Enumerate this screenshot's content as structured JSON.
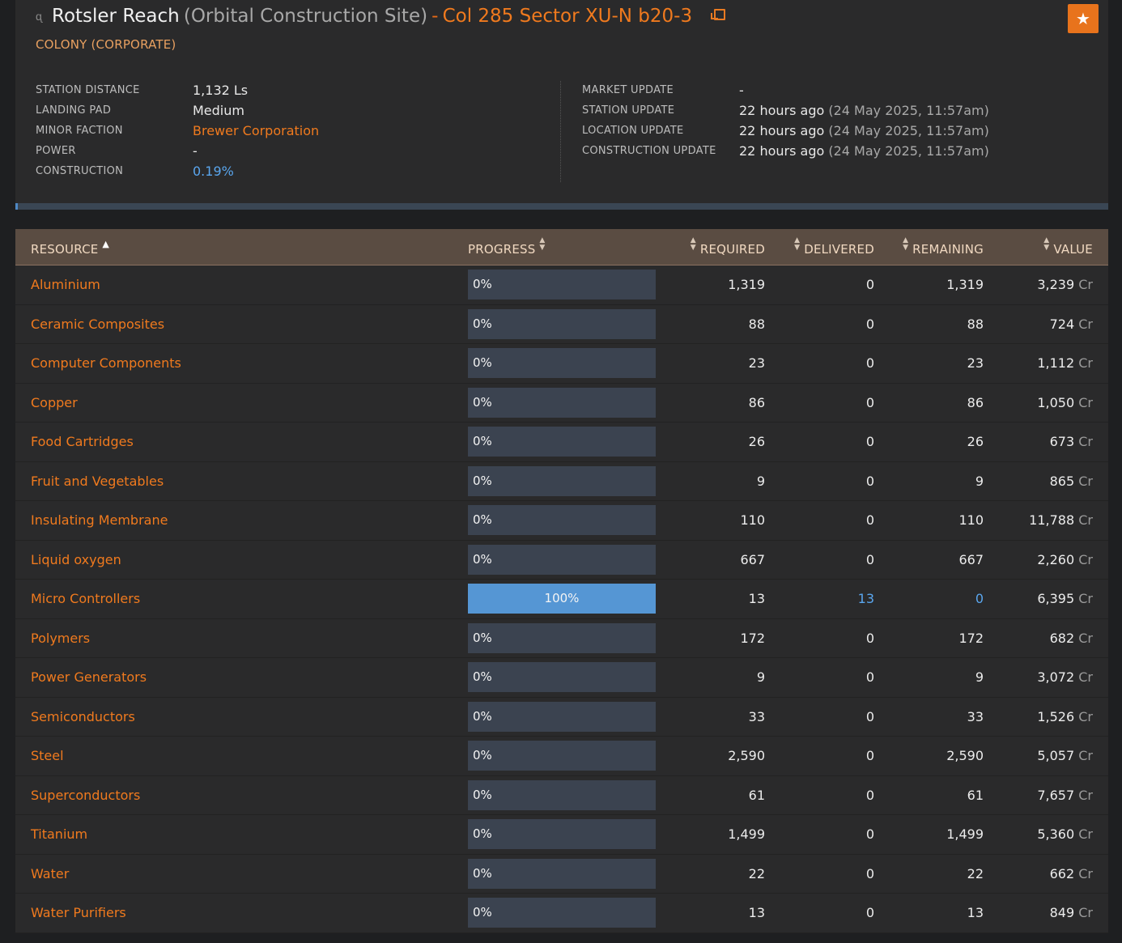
{
  "header": {
    "station_name": "Rotsler Reach",
    "station_type": "(Orbital Construction Site)",
    "separator": "-",
    "system_name": "Col 285 Sector XU-N b20-3",
    "subtitle": "COLONY (CORPORATE)",
    "favorite_icon": "star-icon",
    "station_icon": "station-icon",
    "link_icon": "external-link-icon"
  },
  "info_left": [
    {
      "label": "STATION DISTANCE",
      "value": "1,132 Ls"
    },
    {
      "label": "LANDING PAD",
      "value": "Medium"
    },
    {
      "label": "MINOR FACTION",
      "value": "Brewer Corporation"
    },
    {
      "label": "POWER",
      "value": "-"
    },
    {
      "label": "CONSTRUCTION",
      "value": "0.19%"
    }
  ],
  "info_right": [
    {
      "label": "MARKET UPDATE",
      "value": "-",
      "detail": ""
    },
    {
      "label": "STATION UPDATE",
      "value": "22 hours ago",
      "detail": "(24 May 2025, 11:57am)"
    },
    {
      "label": "LOCATION UPDATE",
      "value": "22 hours ago",
      "detail": "(24 May 2025, 11:57am)"
    },
    {
      "label": "CONSTRUCTION UPDATE",
      "value": "22 hours ago",
      "detail": "(24 May 2025, 11:57am)"
    }
  ],
  "table": {
    "columns": {
      "resource": "RESOURCE",
      "progress": "PROGRESS",
      "required": "REQUIRED",
      "delivered": "DELIVERED",
      "remaining": "REMAINING",
      "value": "VALUE"
    },
    "currency": "Cr",
    "rows": [
      {
        "name": "Aluminium",
        "progress": 0,
        "progress_label": "0%",
        "required": "1,319",
        "delivered": "0",
        "remaining": "1,319",
        "value": "3,239"
      },
      {
        "name": "Ceramic Composites",
        "progress": 0,
        "progress_label": "0%",
        "required": "88",
        "delivered": "0",
        "remaining": "88",
        "value": "724"
      },
      {
        "name": "Computer Components",
        "progress": 0,
        "progress_label": "0%",
        "required": "23",
        "delivered": "0",
        "remaining": "23",
        "value": "1,112"
      },
      {
        "name": "Copper",
        "progress": 0,
        "progress_label": "0%",
        "required": "86",
        "delivered": "0",
        "remaining": "86",
        "value": "1,050"
      },
      {
        "name": "Food Cartridges",
        "progress": 0,
        "progress_label": "0%",
        "required": "26",
        "delivered": "0",
        "remaining": "26",
        "value": "673"
      },
      {
        "name": "Fruit and Vegetables",
        "progress": 0,
        "progress_label": "0%",
        "required": "9",
        "delivered": "0",
        "remaining": "9",
        "value": "865"
      },
      {
        "name": "Insulating Membrane",
        "progress": 0,
        "progress_label": "0%",
        "required": "110",
        "delivered": "0",
        "remaining": "110",
        "value": "11,788"
      },
      {
        "name": "Liquid oxygen",
        "progress": 0,
        "progress_label": "0%",
        "required": "667",
        "delivered": "0",
        "remaining": "667",
        "value": "2,260"
      },
      {
        "name": "Micro Controllers",
        "progress": 100,
        "progress_label": "100%",
        "required": "13",
        "delivered": "13",
        "remaining": "0",
        "value": "6,395"
      },
      {
        "name": "Polymers",
        "progress": 0,
        "progress_label": "0%",
        "required": "172",
        "delivered": "0",
        "remaining": "172",
        "value": "682"
      },
      {
        "name": "Power Generators",
        "progress": 0,
        "progress_label": "0%",
        "required": "9",
        "delivered": "0",
        "remaining": "9",
        "value": "3,072"
      },
      {
        "name": "Semiconductors",
        "progress": 0,
        "progress_label": "0%",
        "required": "33",
        "delivered": "0",
        "remaining": "33",
        "value": "1,526"
      },
      {
        "name": "Steel",
        "progress": 0,
        "progress_label": "0%",
        "required": "2,590",
        "delivered": "0",
        "remaining": "2,590",
        "value": "5,057"
      },
      {
        "name": "Superconductors",
        "progress": 0,
        "progress_label": "0%",
        "required": "61",
        "delivered": "0",
        "remaining": "61",
        "value": "7,657"
      },
      {
        "name": "Titanium",
        "progress": 0,
        "progress_label": "0%",
        "required": "1,499",
        "delivered": "0",
        "remaining": "1,499",
        "value": "5,360"
      },
      {
        "name": "Water",
        "progress": 0,
        "progress_label": "0%",
        "required": "22",
        "delivered": "0",
        "remaining": "22",
        "value": "662"
      },
      {
        "name": "Water Purifiers",
        "progress": 0,
        "progress_label": "0%",
        "required": "13",
        "delivered": "0",
        "remaining": "13",
        "value": "849"
      }
    ]
  },
  "colors": {
    "accent": "#f07a1e",
    "link_blue": "#5aa6ee",
    "progress_fill": "#5596d4",
    "header_bg": "#5a4c42"
  }
}
